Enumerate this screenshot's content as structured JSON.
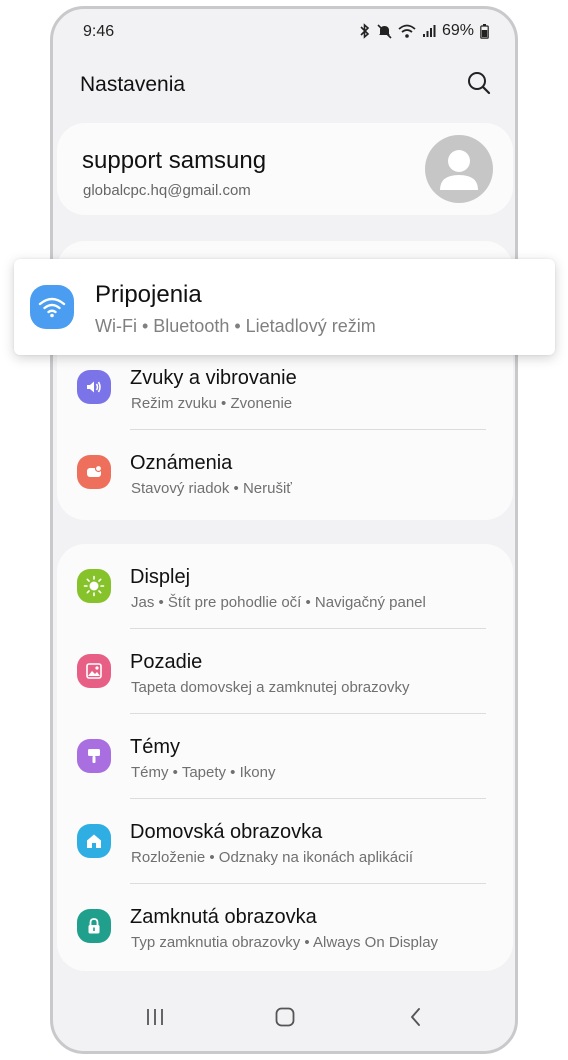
{
  "status_bar": {
    "time": "9:46",
    "battery": "69%"
  },
  "app_bar": {
    "title": "Nastavenia"
  },
  "account": {
    "name": "support samsung",
    "email": "globalcpc.hq@gmail.com"
  },
  "highlighted": {
    "label": "Pripojenia",
    "sub": "Wi-Fi  •  Bluetooth  •  Lietadlový režim",
    "icon": "wifi-icon",
    "color": "#4a9df0"
  },
  "group1": [
    {
      "label": "Zvuky a vibrovanie",
      "sub": "Režim zvuku  •  Zvonenie",
      "icon": "volume-icon",
      "color": "#7b74e8"
    },
    {
      "label": "Oznámenia",
      "sub": "Stavový riadok  •  Nerušiť",
      "icon": "notification-icon",
      "color": "#ee6f5c"
    }
  ],
  "group2": [
    {
      "label": "Displej",
      "sub": "Jas  •  Štít pre pohodlie očí  •  Navigačný panel",
      "icon": "sun-icon",
      "color": "#86c22a"
    },
    {
      "label": "Pozadie",
      "sub": "Tapeta domovskej a zamknutej obrazovky",
      "icon": "image-icon",
      "color": "#e85f86"
    },
    {
      "label": "Témy",
      "sub": "Témy  •  Tapety  •  Ikony",
      "icon": "brush-icon",
      "color": "#a96ee0"
    },
    {
      "label": "Domovská obrazovka",
      "sub": "Rozloženie  •  Odznaky na ikonách aplikácií",
      "icon": "home-icon",
      "color": "#2faee3"
    },
    {
      "label": "Zamknutá obrazovka",
      "sub": "Typ zamknutia obrazovky  •  Always On Display",
      "icon": "lock-icon",
      "color": "#1f9f8c"
    }
  ]
}
